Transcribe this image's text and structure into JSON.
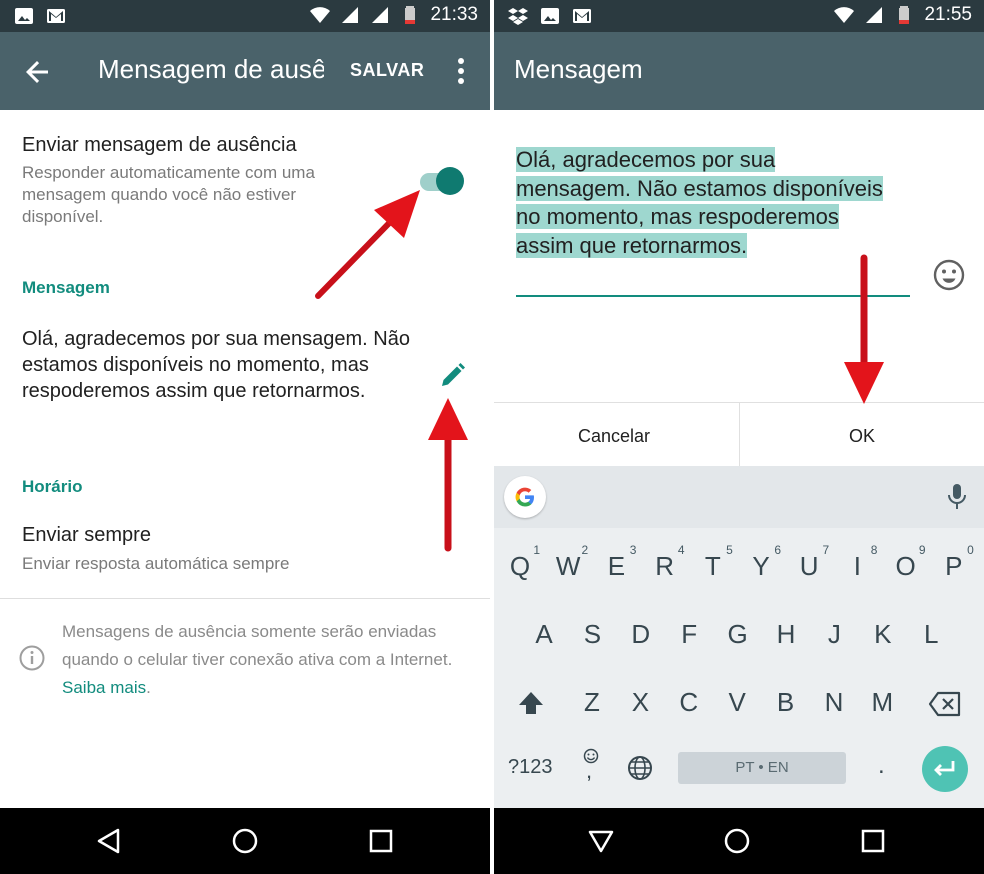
{
  "left_screen": {
    "status": {
      "time": "21:33"
    },
    "appbar": {
      "title": "Mensagem de ausência",
      "save_label": "SALVAR"
    },
    "auto_reply": {
      "title": "Enviar mensagem de ausência",
      "subtitle": "Responder automaticamente com uma mensagem quando você não estiver disponível.",
      "enabled": true
    },
    "message_section": {
      "header": "Mensagem",
      "text": "Olá, agradecemos por sua mensagem. Não estamos disponíveis no momento, mas respoderemos assim que retornarmos."
    },
    "schedule_section": {
      "header": "Horário",
      "title": "Enviar sempre",
      "subtitle": "Enviar resposta automática sempre"
    },
    "note": {
      "text": "Mensagens de ausência somente serão enviadas quando o celular tiver conexão ativa com a Internet. ",
      "link": "Saiba mais",
      "after": "."
    }
  },
  "right_screen": {
    "status": {
      "time": "21:55"
    },
    "appbar": {
      "title": "Mensagem"
    },
    "editor": {
      "value": "Olá, agradecemos por sua mensagem. Não estamos disponíveis no momento, mas respoderemos assim que retornarmos."
    },
    "dialog": {
      "cancel_label": "Cancelar",
      "ok_label": "OK"
    },
    "keyboard": {
      "row1": [
        "Q",
        "W",
        "E",
        "R",
        "T",
        "Y",
        "U",
        "I",
        "O",
        "P"
      ],
      "row1_hints": [
        "1",
        "2",
        "3",
        "4",
        "5",
        "6",
        "7",
        "8",
        "9",
        "0"
      ],
      "row2": [
        "A",
        "S",
        "D",
        "F",
        "G",
        "H",
        "J",
        "K",
        "L"
      ],
      "row3": [
        "Z",
        "X",
        "C",
        "V",
        "B",
        "N",
        "M"
      ],
      "symbols_label": "?123",
      "comma_label": ",",
      "space_label": "PT • EN",
      "period_label": "."
    }
  },
  "colors": {
    "appbar": "#4a626a",
    "statusbar": "#2b3a40",
    "accent": "#128c7e",
    "arrow": "#e3141b"
  }
}
